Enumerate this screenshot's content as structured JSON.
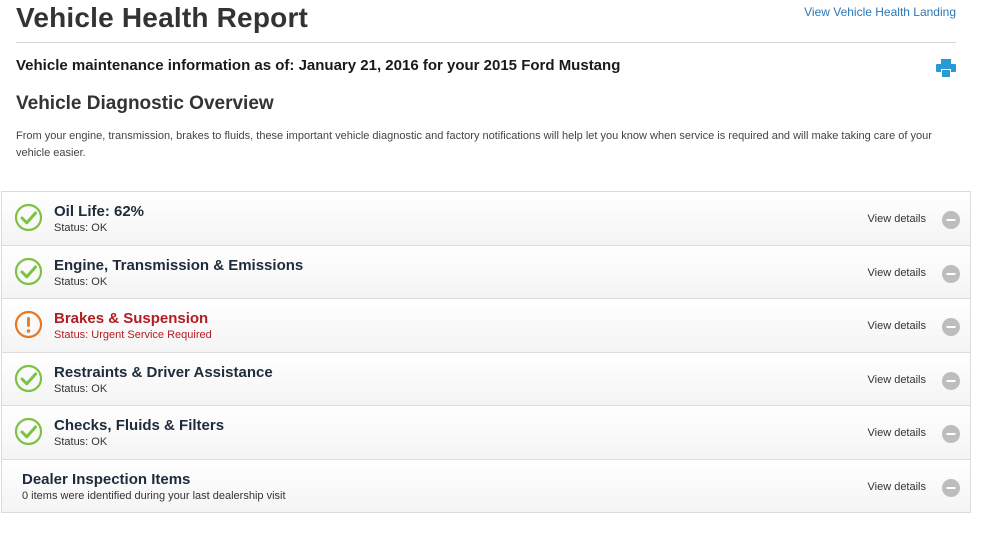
{
  "header": {
    "title": "Vehicle Health Report",
    "landing_link": "View Vehicle Health Landing",
    "info_line": "Vehicle maintenance information as of: January 21, 2016 for your 2015 Ford Mustang",
    "print_icon": "printer-icon"
  },
  "overview": {
    "title": "Vehicle Diagnostic Overview",
    "intro": "From your engine, transmission, brakes to fluids, these important vehicle diagnostic and factory notifications will help let you know when service is required and will make taking care of your vehicle easier."
  },
  "colors": {
    "ok": "#7dc242",
    "urgent": "#e87722",
    "urgent_text": "#b01e23",
    "link": "#2a78b8",
    "toggle": "#bdbdbd"
  },
  "rows": [
    {
      "name": "Oil Life: 62%",
      "status": "Status: OK",
      "details": "View details",
      "icon": "check-circle-icon"
    },
    {
      "name": "Engine, Transmission & Emissions",
      "status": "Status: OK",
      "details": "View details",
      "icon": "check-circle-icon"
    },
    {
      "name": "Brakes & Suspension",
      "status": "Status: Urgent Service Required",
      "details": "View details",
      "icon": "alert-circle-icon"
    },
    {
      "name": "Restraints & Driver Assistance",
      "status": "Status: OK",
      "details": "View details",
      "icon": "check-circle-icon"
    },
    {
      "name": "Checks, Fluids & Filters",
      "status": "Status: OK",
      "details": "View details",
      "icon": "check-circle-icon"
    },
    {
      "name": "Dealer Inspection Items",
      "status": "0 items were identified during your last dealership visit",
      "details": "View details",
      "icon": ""
    }
  ]
}
